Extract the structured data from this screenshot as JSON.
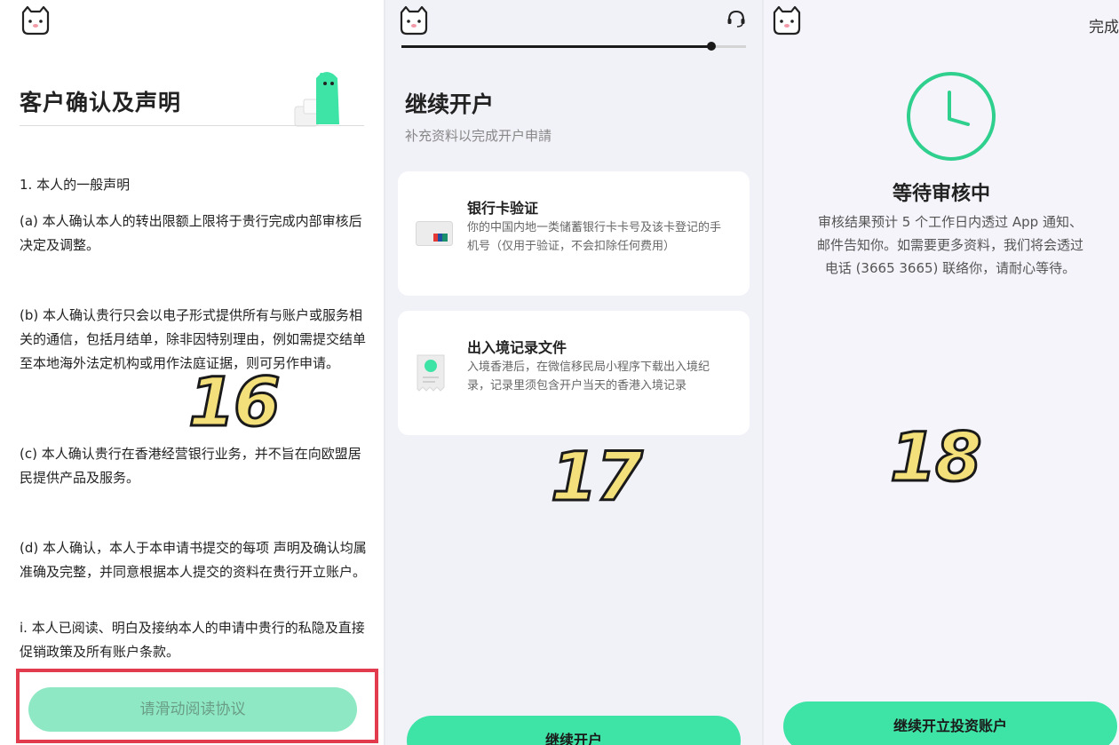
{
  "screen16": {
    "title": "客户确认及声明",
    "section_heading": "1. 本人的一般声明",
    "clauses": [
      "(a)  本人确认本人的转出限额上限将于贵行完成内部审核后决定及调整。",
      "(b)  本人确认贵行只会以电子形式提供所有与账户或服务相关的通信，包括月结单，除非因特别理由，例如需提交结单至本地海外法定机构或用作法庭证据，则可另作申请。",
      "(c)  本人确认贵行在香港经营银行业务，并不旨在向欧盟居民提供产品及服务。",
      "(d)  本人确认，本人于本申请书提交的每项 声明及确认均属准确及完整，并同意根据本人提交的资料在贵行开立账户。",
      " i.  本人已阅读、明白及接纳本人的申请中贵行的私隐及直接促销政策及所有账户条款。"
    ],
    "button": "请滑动阅读协议",
    "step_number": "16"
  },
  "screen17": {
    "progress": 0.9,
    "title": "继续开户",
    "subtitle": "补充资料以完成开户申請",
    "cards": [
      {
        "title": "银行卡验证",
        "desc": "你的中国内地一类储蓄银行卡卡号及该卡登记的手机号（仅用于验证，不会扣除任何费用）",
        "icon": "bank-card-icon"
      },
      {
        "title": "出入境记录文件",
        "desc": "入境香港后，在微信移民局小程序下载出入境纪录，记录里须包含开户当天的香港入境记录",
        "icon": "document-icon"
      }
    ],
    "button": "继续开户",
    "step_number": "17"
  },
  "screen18": {
    "done_label": "完成",
    "title": "等待审核中",
    "desc": "审核结果预计 5 个工作日内透过 App 通知、邮件告知你。如需要更多资料，我们将会透过电话 (3665 3665) 联络你，请耐心等待。",
    "button": "继续开立投资账户",
    "step_number": "18"
  },
  "colors": {
    "accent": "#3ee3a6",
    "accent_light": "#8fe8c4",
    "clock_green": "#2fcf8e",
    "highlight_red": "#e23b4e",
    "number_fill": "#f3e07a"
  }
}
